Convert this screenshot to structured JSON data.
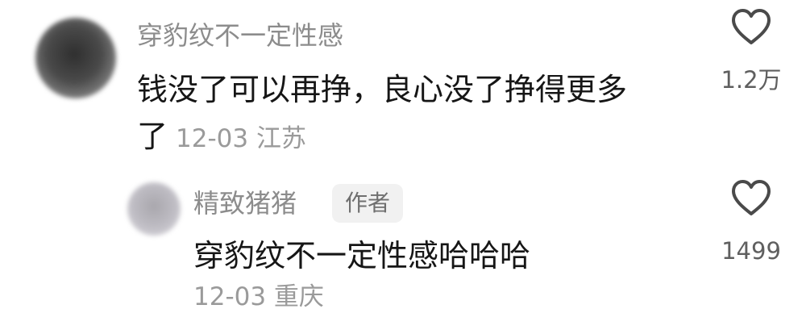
{
  "comment": {
    "username": "穿豹纹不一定性感",
    "text_line1": "钱没了可以再挣，良心没了挣得更多",
    "text_line2": "了",
    "date_location": "12-03 江苏",
    "like_count": "1.2万"
  },
  "reply": {
    "username": "精致猪猪",
    "badge": "作者",
    "text": "穿豹纹不一定性感哈哈哈",
    "date_location": "12-03 重庆",
    "like_count": "1499"
  },
  "icons": {
    "like": "heart-outline-icon"
  }
}
